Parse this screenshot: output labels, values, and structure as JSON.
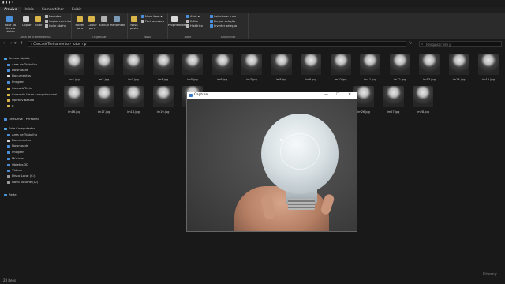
{
  "window": {
    "quick_access": "▮ ▮ ▮ ▾"
  },
  "ribbon_tabs": [
    {
      "label": "Arquivo",
      "active": true
    },
    {
      "label": "Início",
      "active": false
    },
    {
      "label": "Compartilhar",
      "active": false
    },
    {
      "label": "Exibir",
      "active": false
    }
  ],
  "ribbon": {
    "clipboard": {
      "label": "Área de Transferência",
      "pin": "Fixar no Acesso rápido",
      "copy": "Copiar",
      "paste": "Colar",
      "cut": "Recortar",
      "copy_path": "Copiar caminho",
      "paste_shortcut": "Colar atalho"
    },
    "organize": {
      "label": "Organizar",
      "move": "Mover para",
      "copy_to": "Copiar para",
      "delete": "Excluir",
      "rename": "Renomear"
    },
    "new": {
      "label": "Novo",
      "new_folder": "Nova pasta",
      "new_item": "Novo item ▾",
      "easy_access": "Fácil acesso ▾"
    },
    "open": {
      "label": "Abrir",
      "properties": "Propriedades",
      "open": "Abrir ▾",
      "edit": "Editar",
      "history": "Histórico"
    },
    "select": {
      "label": "Selecionar",
      "select_all": "Selecionar tudo",
      "select_none": "Limpar seleção",
      "invert": "Inverter seleção"
    }
  },
  "address": {
    "back": "←",
    "forward": "→",
    "recent": "▾",
    "up": "↑",
    "path": "›  CascadeTreinamento  ›  fotos  ›  p",
    "refresh": "↻",
    "search_placeholder": "Pesquisar em p"
  },
  "sidebar": {
    "items": [
      {
        "label": "Acesso rápido",
        "color": "#4aa3df"
      },
      {
        "label": "Área de Trabalho",
        "color": "#4a8fd9"
      },
      {
        "label": "Downloads",
        "color": "#4a8fd9"
      },
      {
        "label": "Documentos",
        "color": "#d9d9d9"
      },
      {
        "label": "Imagens",
        "color": "#4a8fd9"
      },
      {
        "label": "CascadeTreini",
        "color": "#d9b54a"
      },
      {
        "label": "Curso de Visao computacional",
        "color": "#d9b54a"
      },
      {
        "label": "Opencv Básico",
        "color": "#d9b54a"
      },
      {
        "label": "p",
        "color": "#d9b54a"
      },
      {
        "label": "OneDrive - Personal",
        "color": "#4a8fd9"
      },
      {
        "label": "Este Computador",
        "color": "#4aa3df"
      },
      {
        "label": "Área de Trabalho",
        "color": "#4a8fd9"
      },
      {
        "label": "Documentos",
        "color": "#d9d9d9"
      },
      {
        "label": "Downloads",
        "color": "#4a8fd9"
      },
      {
        "label": "Imagens",
        "color": "#4a8fd9"
      },
      {
        "label": "Músicas",
        "color": "#4a8fd9"
      },
      {
        "label": "Objetos 3D",
        "color": "#4a8fd9"
      },
      {
        "label": "Vídeos",
        "color": "#4a8fd9"
      },
      {
        "label": "Disco Local (C:)",
        "color": "#9a9a9a"
      },
      {
        "label": "Novo volume (D:)",
        "color": "#9a9a9a"
      },
      {
        "label": "Rede",
        "color": "#4a8fd9"
      }
    ]
  },
  "files": {
    "row1": [
      "im1.jpg",
      "im2.jpg",
      "im3.jpg",
      "im4.jpg",
      "im5.jpg",
      "im6.jpg",
      "im7.jpg",
      "im8.jpg",
      "im9.jpg",
      "im10.jpg",
      "im11.jpg",
      "im12.jpg",
      "im13.jpg",
      "im14.jpg",
      "im15.jpg"
    ],
    "row2": [
      "im16.jpg",
      "im17.jpg",
      "im18.jpg",
      "im19.jpg",
      "im20.jpg",
      "im26.jpg",
      "im27.jpg",
      "im28.jpg"
    ]
  },
  "status": {
    "count": "28 itens"
  },
  "capture_window": {
    "title": "Capture",
    "minimize": "—",
    "maximize": "☐",
    "close": "✕"
  },
  "watermark": "Udemy"
}
